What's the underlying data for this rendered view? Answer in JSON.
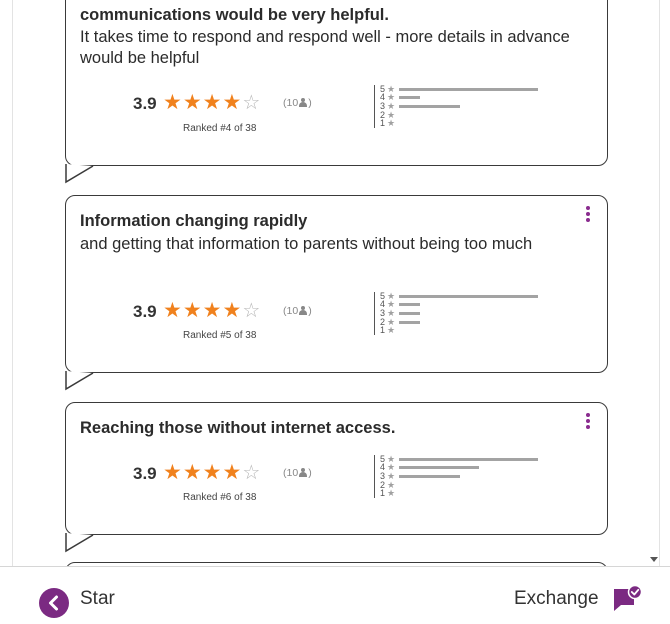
{
  "cards": [
    {
      "title": "communications would be very helpful.",
      "body": "It takes time to respond and respond well - more details in advance would be helpful",
      "score": "3.9",
      "count": "10",
      "rank": "Ranked #4 of 38",
      "distribution": [
        {
          "level": "5",
          "fraction": 0.78
        },
        {
          "level": "4",
          "fraction": 0.12
        },
        {
          "level": "3",
          "fraction": 0.34
        },
        {
          "level": "2",
          "fraction": 0.0
        },
        {
          "level": "1",
          "fraction": 0.0
        }
      ]
    },
    {
      "title": "Information changing rapidly",
      "body": "and getting that information to parents without being too much",
      "score": "3.9",
      "count": "10",
      "rank": "Ranked #5 of 38",
      "distribution": [
        {
          "level": "5",
          "fraction": 0.78
        },
        {
          "level": "4",
          "fraction": 0.12
        },
        {
          "level": "3",
          "fraction": 0.12
        },
        {
          "level": "2",
          "fraction": 0.12
        },
        {
          "level": "1",
          "fraction": 0.0
        }
      ]
    },
    {
      "title": "Reaching those without internet access.",
      "body": "",
      "score": "3.9",
      "count": "10",
      "rank": "Ranked #6 of 38",
      "distribution": [
        {
          "level": "5",
          "fraction": 0.78
        },
        {
          "level": "4",
          "fraction": 0.45
        },
        {
          "level": "3",
          "fraction": 0.34
        },
        {
          "level": "2",
          "fraction": 0.0
        },
        {
          "level": "1",
          "fraction": 0.0
        }
      ]
    }
  ],
  "rating": {
    "full_stars": 4,
    "empty_stars": 1
  },
  "footer": {
    "back_label": "Star",
    "forward_label": "Exchange"
  },
  "colors": {
    "accent": "#7b2a82",
    "star": "#f0811d",
    "bar": "#a3a3a3"
  }
}
